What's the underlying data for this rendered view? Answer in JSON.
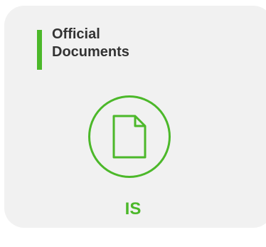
{
  "card": {
    "title": "Official Documents",
    "icon": "document-icon",
    "code": "IS"
  },
  "colors": {
    "accent": "#4cb82a",
    "card_background": "#f1f1f1",
    "title_text": "#333333"
  }
}
